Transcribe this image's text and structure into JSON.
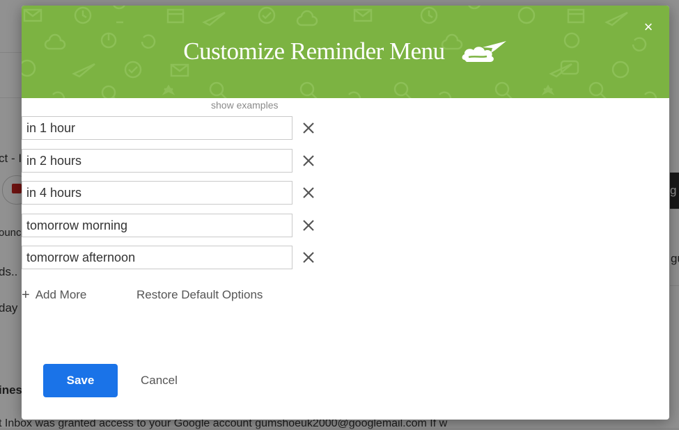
{
  "background": {
    "fragments": [
      "ct - I",
      "ounc",
      "ds..",
      "day",
      "ines",
      "g",
      "gu",
      "t Inbox was granted access to your Google account gumshoeuk2000@googlemail.com If w"
    ]
  },
  "modal": {
    "title": "Customize Reminder Menu",
    "close_label": "×",
    "show_examples": "show examples",
    "options": [
      {
        "value": "in 1 hour"
      },
      {
        "value": "in 2 hours"
      },
      {
        "value": "in 4 hours"
      },
      {
        "value": "tomorrow morning"
      },
      {
        "value": "tomorrow afternoon"
      }
    ],
    "add_more_label": "Add More",
    "add_more_icon": "+",
    "restore_label": "Restore Default Options",
    "save_label": "Save",
    "cancel_label": "Cancel"
  },
  "colors": {
    "header_green": "#7cb342",
    "save_blue": "#1a73e8"
  },
  "icons": {
    "logo": "cloud-paper-plane-icon",
    "remove": "x-icon",
    "close": "close-icon"
  }
}
